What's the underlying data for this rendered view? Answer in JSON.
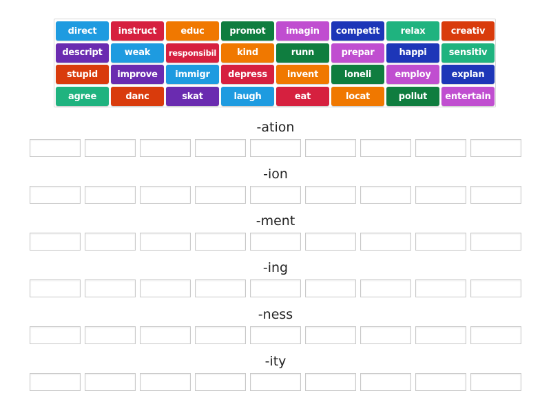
{
  "colors": {
    "blue": "#1e9be0",
    "red": "#d6203f",
    "orange": "#f07800",
    "green": "#0f7d3f",
    "purple": "#6a2bb0",
    "magenta": "#c04ed0",
    "navy": "#1d36b8",
    "teal": "#1fb37f",
    "rust": "#d93b0c"
  },
  "tiles": [
    [
      {
        "t": "direct",
        "c": "blue"
      },
      {
        "t": "instruct",
        "c": "red"
      },
      {
        "t": "educ",
        "c": "orange"
      },
      {
        "t": "promot",
        "c": "green"
      },
      {
        "t": "imagin",
        "c": "magenta"
      },
      {
        "t": "competit",
        "c": "navy"
      },
      {
        "t": "relax",
        "c": "teal"
      },
      {
        "t": "creativ",
        "c": "rust"
      }
    ],
    [
      {
        "t": "descript",
        "c": "purple"
      },
      {
        "t": "weak",
        "c": "blue"
      },
      {
        "t": "responsibil",
        "c": "red"
      },
      {
        "t": "kind",
        "c": "orange"
      },
      {
        "t": "runn",
        "c": "green"
      },
      {
        "t": "prepar",
        "c": "magenta"
      },
      {
        "t": "happi",
        "c": "navy"
      },
      {
        "t": "sensitiv",
        "c": "teal"
      }
    ],
    [
      {
        "t": "stupid",
        "c": "rust"
      },
      {
        "t": "improve",
        "c": "purple"
      },
      {
        "t": "immigr",
        "c": "blue"
      },
      {
        "t": "depress",
        "c": "red"
      },
      {
        "t": "invent",
        "c": "orange"
      },
      {
        "t": "loneli",
        "c": "green"
      },
      {
        "t": "employ",
        "c": "magenta"
      },
      {
        "t": "explan",
        "c": "navy"
      }
    ],
    [
      {
        "t": "agree",
        "c": "teal"
      },
      {
        "t": "danc",
        "c": "rust"
      },
      {
        "t": "skat",
        "c": "purple"
      },
      {
        "t": "laugh",
        "c": "blue"
      },
      {
        "t": "eat",
        "c": "red"
      },
      {
        "t": "locat",
        "c": "orange"
      },
      {
        "t": "pollut",
        "c": "green"
      },
      {
        "t": "entertain",
        "c": "magenta"
      }
    ]
  ],
  "categories": [
    "-ation",
    "-ion",
    "-ment",
    "-ing",
    "-ness",
    "-ity"
  ]
}
